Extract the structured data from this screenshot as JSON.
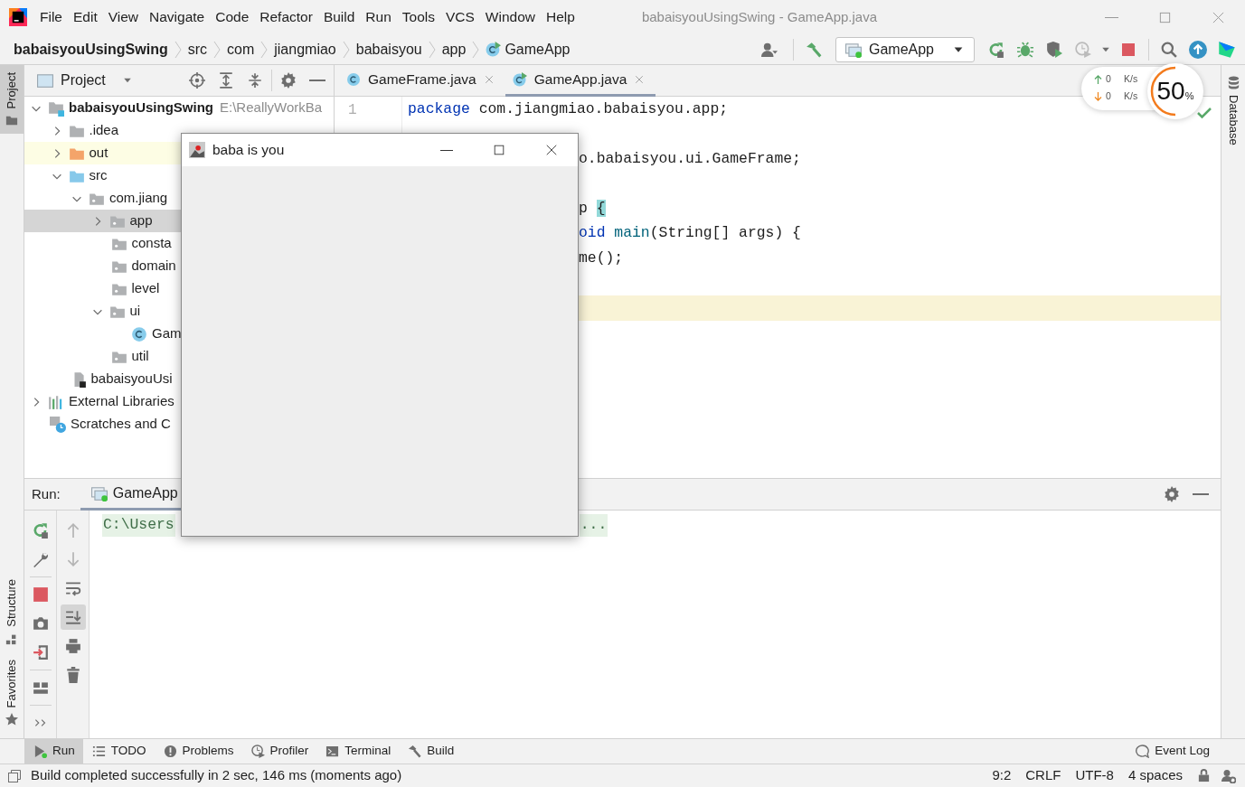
{
  "menu": [
    "File",
    "Edit",
    "View",
    "Navigate",
    "Code",
    "Refactor",
    "Build",
    "Run",
    "Tools",
    "VCS",
    "Window",
    "Help"
  ],
  "window_title": "babaisyouUsingSwing - GameApp.java",
  "breadcrumbs": [
    {
      "label": "babaisyouUsingSwing",
      "kind": "project"
    },
    {
      "label": "src",
      "kind": "folder"
    },
    {
      "label": "com",
      "kind": "folder"
    },
    {
      "label": "jiangmiao",
      "kind": "folder"
    },
    {
      "label": "babaisyou",
      "kind": "folder"
    },
    {
      "label": "app",
      "kind": "folder"
    },
    {
      "label": "GameApp",
      "kind": "class"
    }
  ],
  "run_config": {
    "label": "GameApp"
  },
  "memory_widget": {
    "upload": "0",
    "upload_unit": "K/s",
    "download": "0",
    "download_unit": "K/s",
    "percent": "50",
    "percent_sign": "%",
    "level": 0.5
  },
  "left_strip": {
    "top": [
      {
        "label": "Project",
        "selected": true
      }
    ],
    "bottom": [
      {
        "label": "Structure",
        "selected": false
      },
      {
        "label": "Favorites",
        "selected": false
      }
    ]
  },
  "project_panel": {
    "title": "Project",
    "tree": [
      {
        "label": "babaisyouUsingSwing",
        "path": "E:\\ReallyWorkBa",
        "kind": "module",
        "expanded": true,
        "selected": false,
        "children": [
          {
            "label": ".idea",
            "kind": "folder",
            "expanded": false,
            "selected": false
          },
          {
            "label": "out",
            "kind": "excluded",
            "expanded": false,
            "selected": false
          },
          {
            "label": "src",
            "kind": "source",
            "expanded": true,
            "selected": false,
            "children": [
              {
                "label": "com.jiang",
                "kind": "package",
                "expanded": true,
                "selected": false,
                "children": [
                  {
                    "label": "app",
                    "kind": "package",
                    "expanded": false,
                    "selected": true
                  },
                  {
                    "label": "consta",
                    "kind": "package",
                    "selected": false
                  },
                  {
                    "label": "domain",
                    "kind": "package",
                    "selected": false
                  },
                  {
                    "label": "level",
                    "kind": "package",
                    "selected": false
                  },
                  {
                    "label": "ui",
                    "kind": "package",
                    "expanded": true,
                    "selected": false,
                    "children": [
                      {
                        "label": "Gam",
                        "kind": "class",
                        "selected": false
                      }
                    ]
                  },
                  {
                    "label": "util",
                    "kind": "package",
                    "selected": false
                  }
                ]
              }
            ]
          },
          {
            "label": "babaisyouUsi",
            "kind": "iml",
            "selected": false
          }
        ]
      },
      {
        "label": "External Libraries",
        "kind": "libraries",
        "expanded": false,
        "selected": false
      },
      {
        "label": "Scratches and C",
        "kind": "scratches",
        "selected": false
      }
    ]
  },
  "editor": {
    "tabs": [
      {
        "label": "GameFrame.java",
        "kind": "class",
        "selected": false
      },
      {
        "label": "GameApp.java",
        "kind": "class-run",
        "selected": true
      }
    ],
    "lines": [
      {
        "number": "1",
        "current": false,
        "segments": [
          {
            "text": "package",
            "kind": "keyword"
          },
          {
            "text": " com.jiangmiao.babaisyou.app;",
            "kind": "plain"
          }
        ]
      },
      {
        "current": false
      },
      {
        "current": false,
        "segments": [
          {
            "text": "o.babaisyou.ui.GameFrame;",
            "kind": "plain"
          }
        ]
      },
      {
        "current": false
      },
      {
        "current": false,
        "segments": [
          {
            "text": "p ",
            "kind": "plain"
          },
          {
            "text": "{",
            "kind": "brace-match"
          }
        ]
      },
      {
        "current": false,
        "segments": [
          {
            "text": "oid ",
            "kind": "keyword"
          },
          {
            "text": "main",
            "kind": "method"
          },
          {
            "text": "(String[] args) {",
            "kind": "plain"
          }
        ]
      },
      {
        "current": false,
        "segments": [
          {
            "text": "me();",
            "kind": "plain"
          }
        ]
      },
      {
        "current": false
      },
      {
        "current": true
      }
    ]
  },
  "right_strip": {
    "label": "Database"
  },
  "popup_window": {
    "title": "baba is you"
  },
  "run_panel": {
    "label": "Run:",
    "tab": "GameApp",
    "console_start": "C:\\Users",
    "console_end": "..."
  },
  "tool_windows": [
    {
      "label": "Run",
      "kind": "run",
      "selected": true
    },
    {
      "label": "TODO",
      "kind": "list",
      "selected": false
    },
    {
      "label": "Problems",
      "kind": "problems",
      "selected": false
    },
    {
      "label": "Profiler",
      "kind": "profiler",
      "selected": false
    },
    {
      "label": "Terminal",
      "kind": "terminal",
      "selected": false
    },
    {
      "label": "Build",
      "kind": "build",
      "selected": false
    }
  ],
  "event_log": "Event Log",
  "status_bar": {
    "message": "Build completed successfully in 2 sec, 146 ms (moments ago)",
    "items": [
      "9:2",
      "CRLF",
      "UTF-8",
      "4 spaces"
    ]
  }
}
